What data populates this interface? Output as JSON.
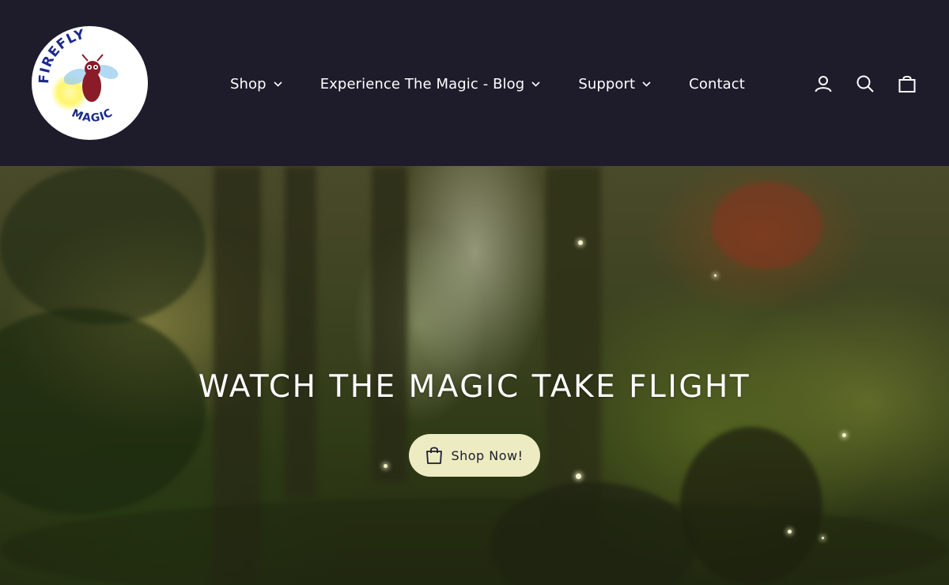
{
  "brand": {
    "logo_text_top": "FIREFLY",
    "logo_text_bottom": "MAGIC",
    "logo_colors": {
      "text": "#1b2a8c",
      "firefly_body": "#8a1c2a",
      "glow": "#fff45a"
    }
  },
  "nav": {
    "items": [
      {
        "label": "Shop",
        "has_dropdown": true
      },
      {
        "label": "Experience The Magic - Blog",
        "has_dropdown": true
      },
      {
        "label": "Support",
        "has_dropdown": true
      },
      {
        "label": "Contact",
        "has_dropdown": false
      }
    ]
  },
  "header_icons": [
    {
      "name": "account-icon"
    },
    {
      "name": "search-icon"
    },
    {
      "name": "cart-icon"
    }
  ],
  "hero": {
    "title": "WATCH THE MAGIC TAKE FLIGHT",
    "cta_label": "Shop Now!",
    "cta_icon": "shopping-bag-icon"
  },
  "colors": {
    "header_bg": "#1e1c2b",
    "cta_bg": "#ecebc2",
    "nav_text": "#ffffff"
  }
}
